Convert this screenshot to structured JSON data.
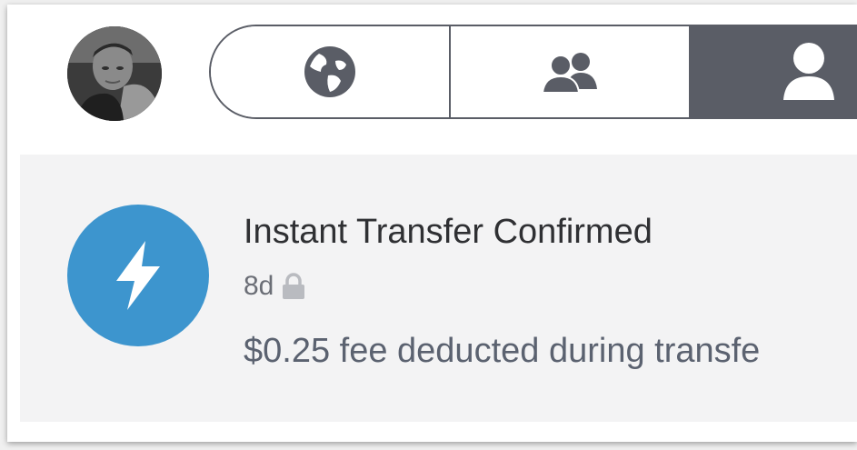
{
  "header": {
    "avatar_alt": "profile photo",
    "tabs": [
      {
        "name": "public",
        "icon": "globe-icon",
        "selected": false
      },
      {
        "name": "friends",
        "icon": "friends-icon",
        "selected": false
      },
      {
        "name": "personal",
        "icon": "person-icon",
        "selected": true
      }
    ]
  },
  "story": {
    "icon": "lightning-bolt-icon",
    "icon_color": "#3d95ce",
    "title": "Instant Transfer Confirmed",
    "time": "8d",
    "privacy_icon": "lock-icon",
    "note": "$0.25 fee deducted during transfe"
  },
  "colors": {
    "segment_border": "#5a5d66",
    "selected_segment": "#5a5d66",
    "feed_background": "#f3f3f4"
  }
}
